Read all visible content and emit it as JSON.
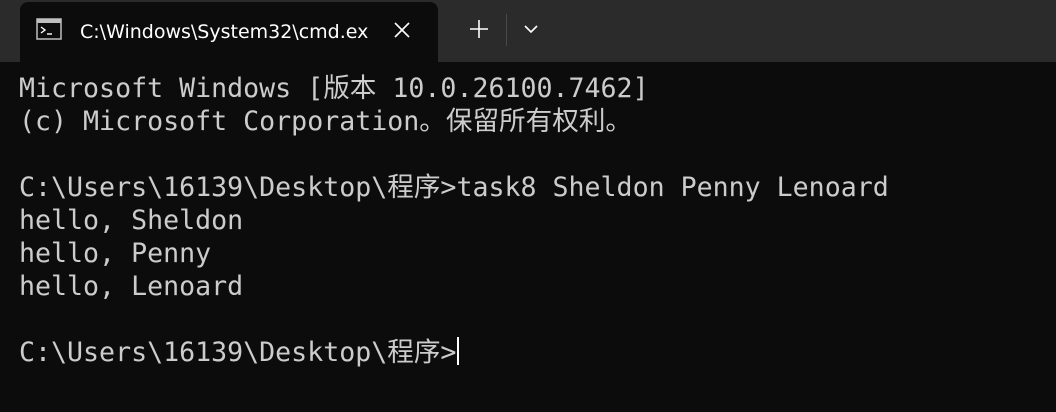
{
  "tab": {
    "title": "C:\\Windows\\System32\\cmd.ex",
    "icon": "cmd-prompt-icon",
    "close_icon": "close-icon"
  },
  "toolbar": {
    "new_tab_icon": "plus-icon",
    "dropdown_icon": "chevron-down-icon"
  },
  "terminal": {
    "lines": [
      "Microsoft Windows [版本 10.0.26100.7462]",
      "(c) Microsoft Corporation。保留所有权利。",
      "",
      "C:\\Users\\16139\\Desktop\\程序>task8 Sheldon Penny Lenoard",
      "hello, Sheldon",
      "hello, Penny",
      "hello, Lenoard",
      "",
      "C:\\Users\\16139\\Desktop\\程序>"
    ],
    "text_color": "#cccccc",
    "background_color": "#0c0c0c"
  }
}
